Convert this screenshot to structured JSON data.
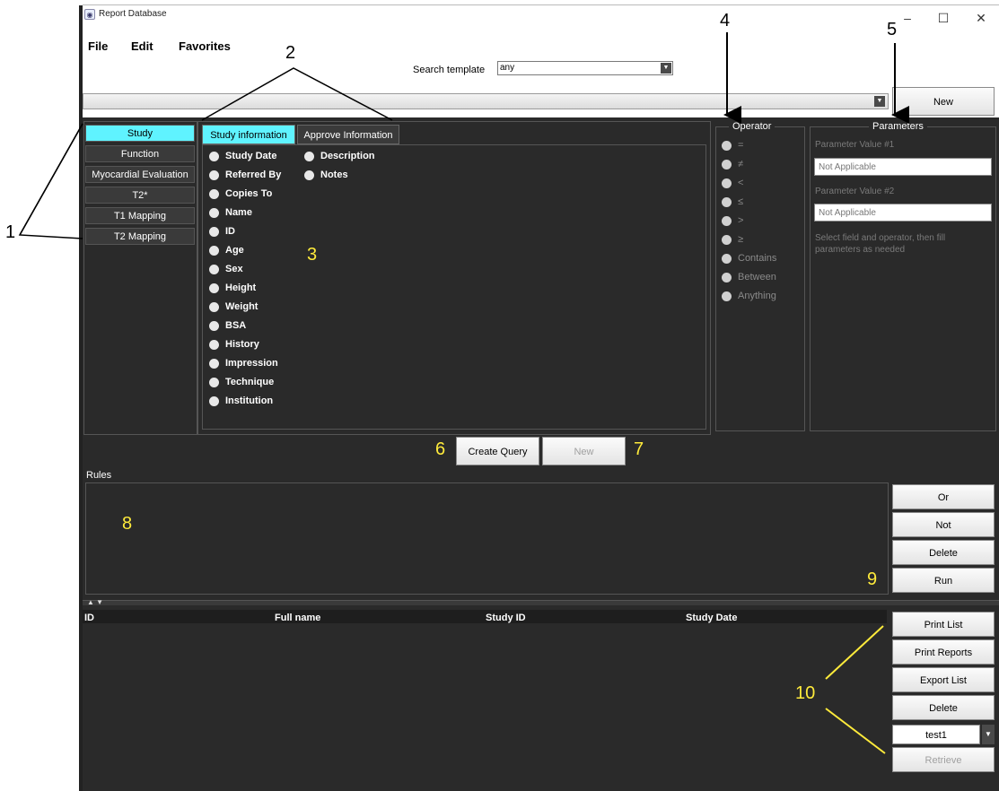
{
  "app": {
    "title": "Report Database"
  },
  "menu": {
    "file": "File",
    "edit": "Edit",
    "favorites": "Favorites"
  },
  "window": {
    "minimize": "‒",
    "maximize": "☐",
    "close": "✕"
  },
  "search": {
    "label": "Search template",
    "value": "any"
  },
  "toolbar": {
    "new_label": "New"
  },
  "left_tabs": [
    "Study",
    "Function",
    "Myocardial Evaluation",
    "T2*",
    "T1 Mapping",
    "T2 Mapping"
  ],
  "info_tabs": [
    "Study information",
    "Approve Information"
  ],
  "fields_col1": [
    "Study Date",
    "Referred By",
    "Copies To",
    "Name",
    "ID",
    "Age",
    "Sex",
    "Height",
    "Weight",
    "BSA",
    "History",
    "Impression",
    "Technique",
    "Institution"
  ],
  "fields_col2": [
    "Description",
    "Notes"
  ],
  "operator": {
    "title": "Operator",
    "items": [
      "=",
      "≠",
      "<",
      "≤",
      ">",
      "≥",
      "Contains",
      "Between",
      "Anything"
    ]
  },
  "parameters": {
    "title": "Parameters",
    "label1": "Parameter Value #1",
    "value1": "Not Applicable",
    "label2": "Parameter Value #2",
    "value2": "Not Applicable",
    "hint": "Select field and operator, then fill parameters as needed"
  },
  "query": {
    "create_label": "Create Query",
    "new_label": "New"
  },
  "rules": {
    "title": "Rules",
    "or": "Or",
    "not": "Not",
    "delete": "Delete",
    "run": "Run"
  },
  "results": {
    "columns": [
      "ID",
      "Full name",
      "Study ID",
      "Study Date"
    ],
    "print_list": "Print List",
    "print_reports": "Print Reports",
    "export_list": "Export List",
    "delete": "Delete",
    "saved_query": "test1",
    "retrieve": "Retrieve"
  },
  "annotations": {
    "n1": "1",
    "n2": "2",
    "n3": "3",
    "n4": "4",
    "n5": "5",
    "n6": "6",
    "n7": "7",
    "n8": "8",
    "n9": "9",
    "n10": "10"
  },
  "colors": {
    "accent": "#5ff3ff",
    "panel": "#2a2a2a",
    "callout_yellow": "#ffeb3b"
  }
}
